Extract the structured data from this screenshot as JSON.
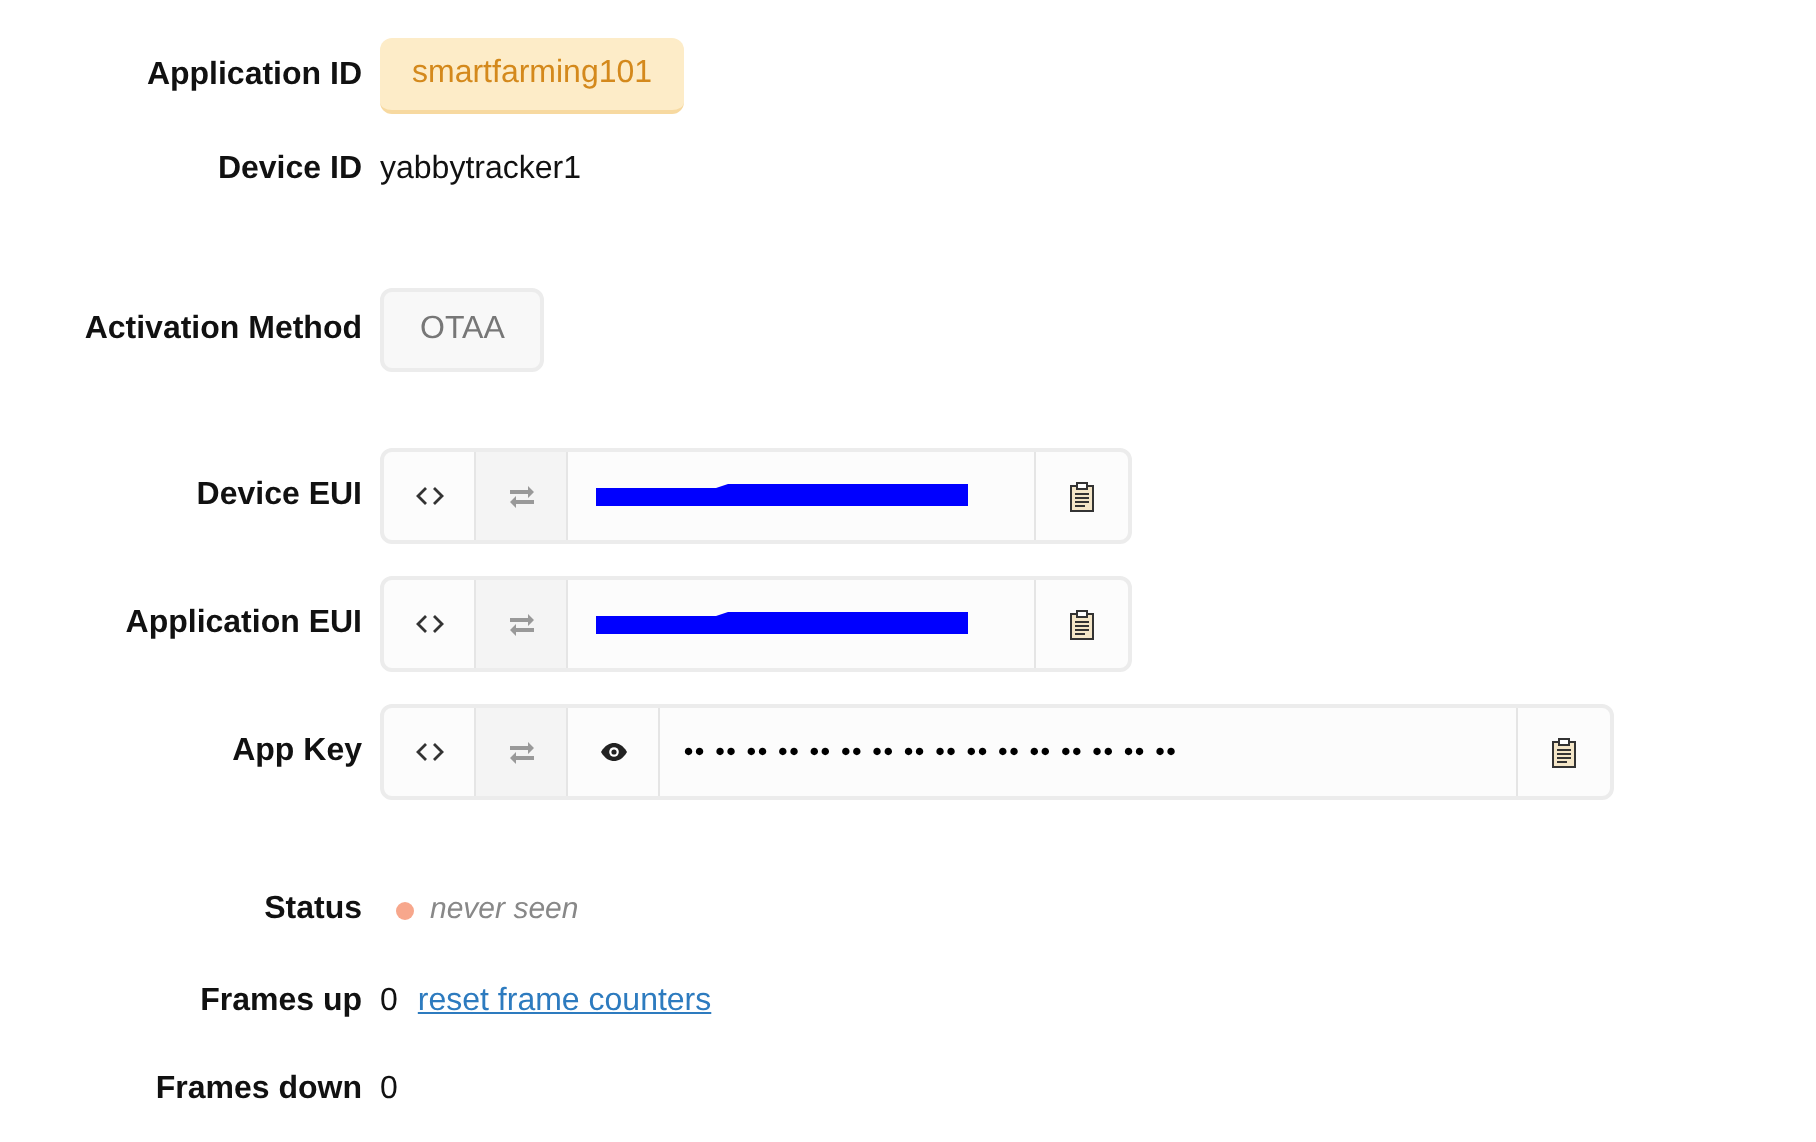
{
  "fields": [
    {
      "kind": "badge",
      "label": "Application ID",
      "value": "smartfarming101"
    },
    {
      "kind": "text",
      "label": "Device ID",
      "value": "yabbytracker1"
    },
    {
      "kind": "tag",
      "label": "Activation Method",
      "value": "OTAA"
    },
    {
      "kind": "eui",
      "label": "Device EUI",
      "redacted": true
    },
    {
      "kind": "eui",
      "label": "Application EUI",
      "redacted": true
    },
    {
      "kind": "key",
      "label": "App Key",
      "value": "•• •• •• •• •• •• •• •• •• •• •• •• •• •• •• ••"
    },
    {
      "kind": "status",
      "label": "Status",
      "value": "never seen",
      "color": "#f7a78c"
    },
    {
      "kind": "counter",
      "label": "Frames up",
      "value": "0",
      "link": "reset frame counters"
    },
    {
      "kind": "counter",
      "label": "Frames down",
      "value": "0"
    }
  ]
}
